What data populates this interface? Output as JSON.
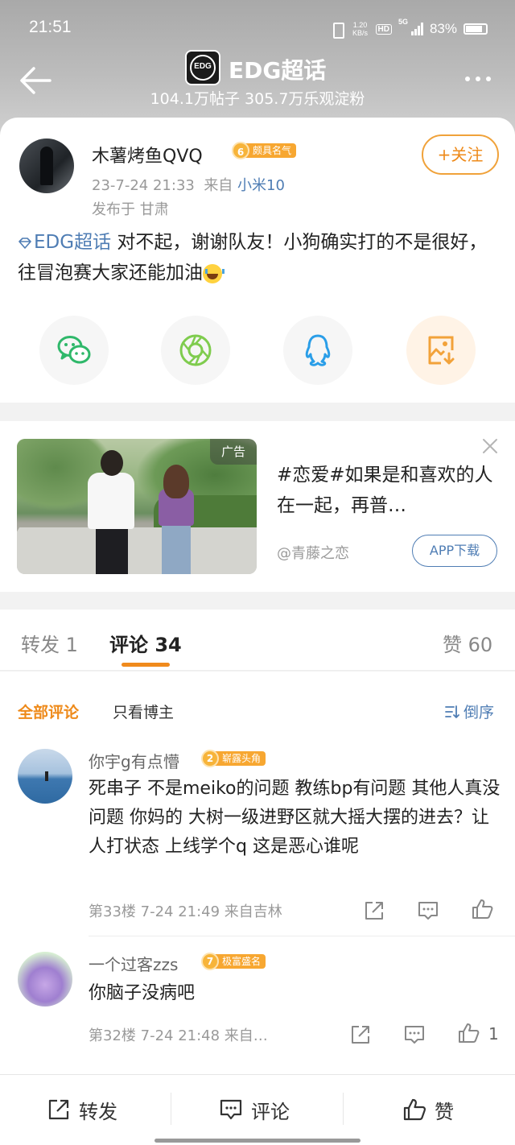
{
  "status_bar": {
    "time": "21:51",
    "net_speed": "1.20",
    "net_unit": "KB/s",
    "hd": "HD",
    "network": "5G",
    "battery": "83%"
  },
  "header": {
    "logo_text": "EDG",
    "title": "EDG超话",
    "stats": "104.1万帖子 305.7万乐观淀粉",
    "back_icon": "arrow-left-icon",
    "more_icon": "more-dots-icon"
  },
  "post": {
    "author": "木薯烤鱼QVQ",
    "level": "6",
    "level_title": "颇具名气",
    "timestamp": "23-7-24 21:33",
    "from_label": "来自",
    "device": "小米10",
    "location": "发布于 甘肃",
    "follow_label": "+关注",
    "tag": "EDG超话",
    "text": " 对不起，谢谢队友！小狗确实打的不是很好，往冒泡赛大家还能加油",
    "share_icons": [
      "wechat-icon",
      "moments-icon",
      "qq-icon",
      "save-image-icon"
    ]
  },
  "ad": {
    "label": "广告",
    "text": "#恋爱#如果是和喜欢的人在一起，再普…",
    "source": "@青藤之恋",
    "download_label": "APP下载",
    "close_icon": "close-icon"
  },
  "tabs": {
    "repost": "转发 1",
    "comment": "评论 34",
    "like": "赞 60"
  },
  "filters": {
    "all": "全部评论",
    "blogger_only": "只看博主",
    "sort": "倒序"
  },
  "comments": [
    {
      "name": "你宇g有点懵",
      "level": "2",
      "level_title": "崭露头角",
      "text": "死串子 不是meiko的问题 教练bp有问题 其他人真没问题 你妈的 大树一级进野区就大摇大摆的进去？让人打状态 上线学个q 这是恶心谁呢",
      "meta": "第33楼 7-24 21:49 来自吉林",
      "likes": ""
    },
    {
      "name": "一个过客zzs",
      "level": "7",
      "level_title": "极富盛名",
      "text": "你脑子没病吧",
      "meta": "第32楼 7-24 21:48 来自…",
      "likes": "1"
    }
  ],
  "bottom_bar": {
    "repost": "转发",
    "comment": "评论",
    "like": "赞"
  },
  "colors": {
    "accent": "#ee8a1a",
    "link": "#4f7db4",
    "badge": "#f7a731"
  }
}
